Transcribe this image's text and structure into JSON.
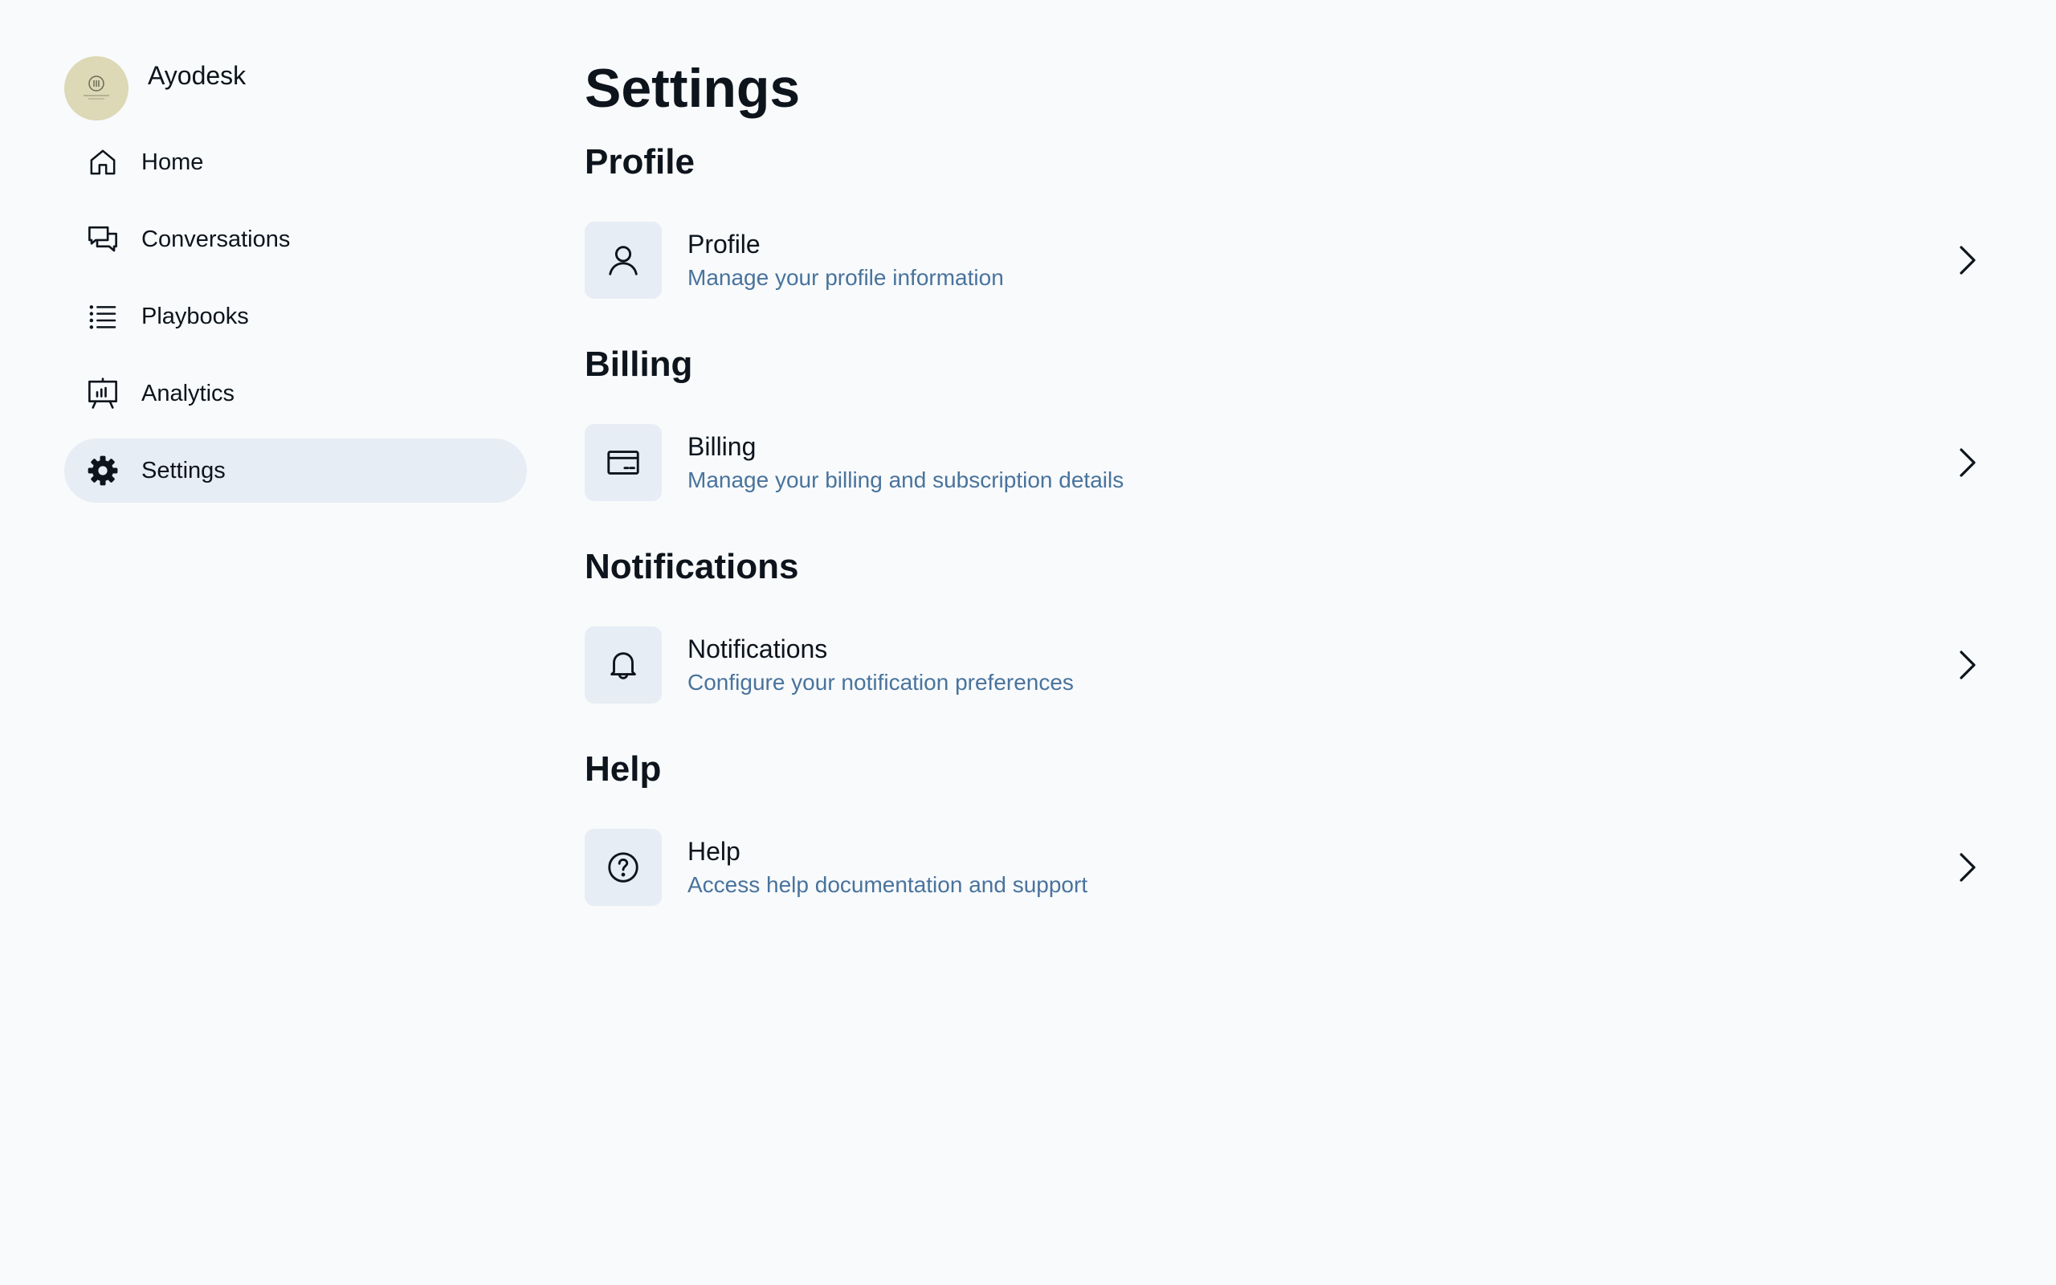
{
  "brand": {
    "name": "Ayodesk"
  },
  "sidebar": {
    "items": [
      {
        "label": "Home",
        "icon": "house-icon",
        "active": false
      },
      {
        "label": "Conversations",
        "icon": "chat-bubbles-icon",
        "active": false
      },
      {
        "label": "Playbooks",
        "icon": "list-icon",
        "active": false
      },
      {
        "label": "Analytics",
        "icon": "presentation-chart-icon",
        "active": false
      },
      {
        "label": "Settings",
        "icon": "gear-icon",
        "active": true
      }
    ]
  },
  "main": {
    "title": "Settings",
    "sections": [
      {
        "heading": "Profile",
        "title": "Profile",
        "subtitle": "Manage your profile information",
        "icon": "user-icon"
      },
      {
        "heading": "Billing",
        "title": "Billing",
        "subtitle": "Manage your billing and subscription details",
        "icon": "credit-card-icon"
      },
      {
        "heading": "Notifications",
        "title": "Notifications",
        "subtitle": "Configure your notification preferences",
        "icon": "bell-icon"
      },
      {
        "heading": "Help",
        "title": "Help",
        "subtitle": "Access help documentation and support",
        "icon": "question-circle-icon"
      }
    ]
  },
  "colors": {
    "background": "#f8fafc",
    "text": "#0d141c",
    "subtext": "#49739c",
    "active_bg": "#e7edf4",
    "avatar_bg": "#ddd8b5"
  }
}
